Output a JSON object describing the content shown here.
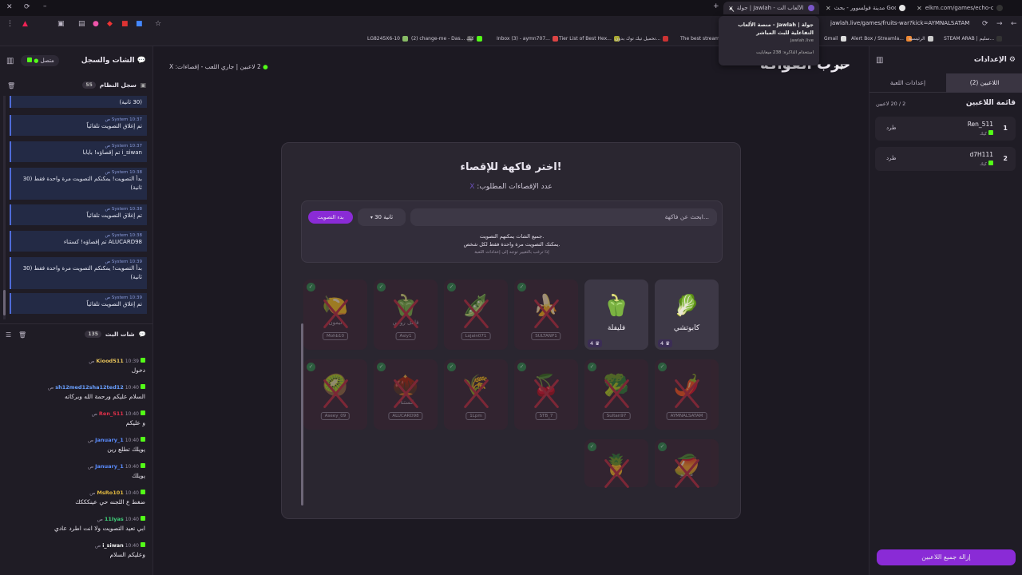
{
  "browser": {
    "tabs": [
      {
        "label": "جولة | Jawlah - منصة الألعاب الت..."
      },
      {
        "label": "مدينة فولسوور - بحث Google"
      },
      {
        "label": "elkm.com/games/echo-code"
      }
    ],
    "url": "jawlah.live/games/fruits-war?kick=AYMNALSATAM",
    "tooltip": {
      "title": "جولة | Jawlah - منصة الألعاب التفاعلية للبث المباشر",
      "domain": "jawlah.live",
      "memory": "استخدام الذاكرة: 238 ميغابايت"
    },
    "bookmarks": [
      "LG8245X6-10",
      "(2) change-me - Das...",
      "كيك",
      "Inbox (3) - aymn707...",
      "Tier List of Best Hex...",
      "تحميل تيك توك بدون...",
      "The best streami...",
      "Gmail",
      "Alert Box / Streamla...",
      "الرئيسية",
      "STEAM ARAB | سليم..."
    ]
  },
  "left_panel": {
    "title": "الشات والسجل",
    "status": "متصل",
    "system_log": {
      "label": "سجل النظام",
      "count": "55"
    },
    "system_messages": [
      {
        "meta": "",
        "text": "(30 ثانية)"
      },
      {
        "meta": "System 10:37 ص",
        "text": "تم إغلاق التصويت تلقائياً"
      },
      {
        "meta": "System 10:37 ص",
        "text": "i_siwan تم إقصاؤه! بايابا"
      },
      {
        "meta": "System 10:38 ص",
        "text": "بدأ التصويت! يمكنكم التصويت مرة واحدة فقط (30 ثانية)"
      },
      {
        "meta": "System 10:38 ص",
        "text": "تم إغلاق التصويت تلقائياً"
      },
      {
        "meta": "System 10:38 ص",
        "text": "ALUCARD98 تم إقصاؤه! كستناء"
      },
      {
        "meta": "System 10:39 ص",
        "text": "بدأ التصويت! يمكنكم التصويت مرة واحدة فقط (30 ثانية)"
      },
      {
        "meta": "System 10:39 ص",
        "text": "تم إغلاق التصويت تلقائياً"
      }
    ],
    "stream_chat": {
      "label": "شات البث",
      "count": "135"
    },
    "chat_messages": [
      {
        "nick": "Kiood511",
        "time": "10:39 ص",
        "text": "دخول",
        "color": "#e6c25a"
      },
      {
        "nick": "sh12med12sha12ted12",
        "time": "10:40 ص",
        "text": "السلام عليكم ورحمة الله وبركاته",
        "color": "#6aa0ff"
      },
      {
        "nick": "Ren_511",
        "time": "10:40 ص",
        "text": "و عليكم",
        "color": "#e0304a"
      },
      {
        "nick": "January_1",
        "time": "10:40 ص",
        "text": "يويلك تطلع رين",
        "color": "#5a8cff"
      },
      {
        "nick": "January_1",
        "time": "10:40 ص",
        "text": "يويلك",
        "color": "#5a8cff"
      },
      {
        "nick": "MsRo101",
        "time": "10:40 ص",
        "text": "ضغط ع اللجنه حي عينكككك",
        "color": "#e0b840"
      },
      {
        "nick": "11Iyas",
        "time": "10:40 ص",
        "text": "ابي تعيد التصويت ولا انت اطرد عادي",
        "color": "#3fd07a"
      },
      {
        "nick": "i_siwan",
        "time": "10:40 ص",
        "text": "وعليكم السلام",
        "color": "#f1f1f1"
      }
    ]
  },
  "main": {
    "page_title": "حرب الفواكه",
    "status_bar": "2 لاعبين | جاري اللعب - إقصاءات: X",
    "panel": {
      "heading": "اختر فاكهة للإقصاء!",
      "subheading": "عدد الإقصاءات المطلوب:",
      "subheading_x": "X",
      "search_placeholder": "ابحث عن فاكهة...",
      "duration": "30 ثانية",
      "start_vote": "بدء التصويت",
      "info1": "جميع الشات يمكنهم التصويت.",
      "info2": "يمكنك التصويت مرة واحدة فقط لكل شخص.",
      "info3": "إذا ترغب بالتغيير توجه إلى إعدادات اللعبة"
    },
    "fruits": [
      {
        "emoji": "🥬",
        "name": "كابوتشي",
        "votes": "4",
        "player": "",
        "eliminated": false
      },
      {
        "emoji": "🫑",
        "name": "فليفلة",
        "votes": "4",
        "player": "",
        "eliminated": false
      },
      {
        "emoji": "🍌",
        "name": "",
        "player": "SULTANP1",
        "eliminated": true
      },
      {
        "emoji": "🫛",
        "name": "",
        "player": "Lojain071",
        "eliminated": true
      },
      {
        "emoji": "🫑",
        "name": "فلفل رومي",
        "player": "Asiy1",
        "eliminated": true
      },
      {
        "emoji": "🍋",
        "name": "ليمون",
        "player": "Mohb10",
        "eliminated": true
      },
      {
        "emoji": "🌶️",
        "name": "",
        "player": "AYMNALSATAM",
        "eliminated": true
      },
      {
        "emoji": "🥦",
        "name": "",
        "player": "Sultan97",
        "eliminated": true
      },
      {
        "emoji": "🍒",
        "name": "",
        "player": "STB_7",
        "eliminated": true
      },
      {
        "emoji": "🌾",
        "name": "",
        "player": "1Lpm",
        "eliminated": true
      },
      {
        "emoji": "🌰",
        "name": "كستناء",
        "player": "ALUCARD98",
        "eliminated": true
      },
      {
        "emoji": "🥝",
        "name": "",
        "player": "Aseey_09",
        "eliminated": true
      },
      {
        "emoji": "🥭",
        "name": "مانجو",
        "player": "",
        "eliminated": true
      },
      {
        "emoji": "🍍",
        "name": "",
        "player": "",
        "eliminated": true
      }
    ]
  },
  "right_panel": {
    "title": "الإعدادات",
    "tabs": [
      "اللاعبين (2)",
      "إعدادات اللعبة"
    ],
    "list_title": "قائمة اللاعبين",
    "count": "2 / 20 لاعبين",
    "players": [
      {
        "index": "1",
        "name": "Ren_511",
        "platform": "كيك",
        "kick": "طرد"
      },
      {
        "index": "2",
        "name": "d7H111",
        "platform": "كيك",
        "kick": "طرد"
      }
    ],
    "remove_all": "إزالة جميع اللاعبين"
  }
}
